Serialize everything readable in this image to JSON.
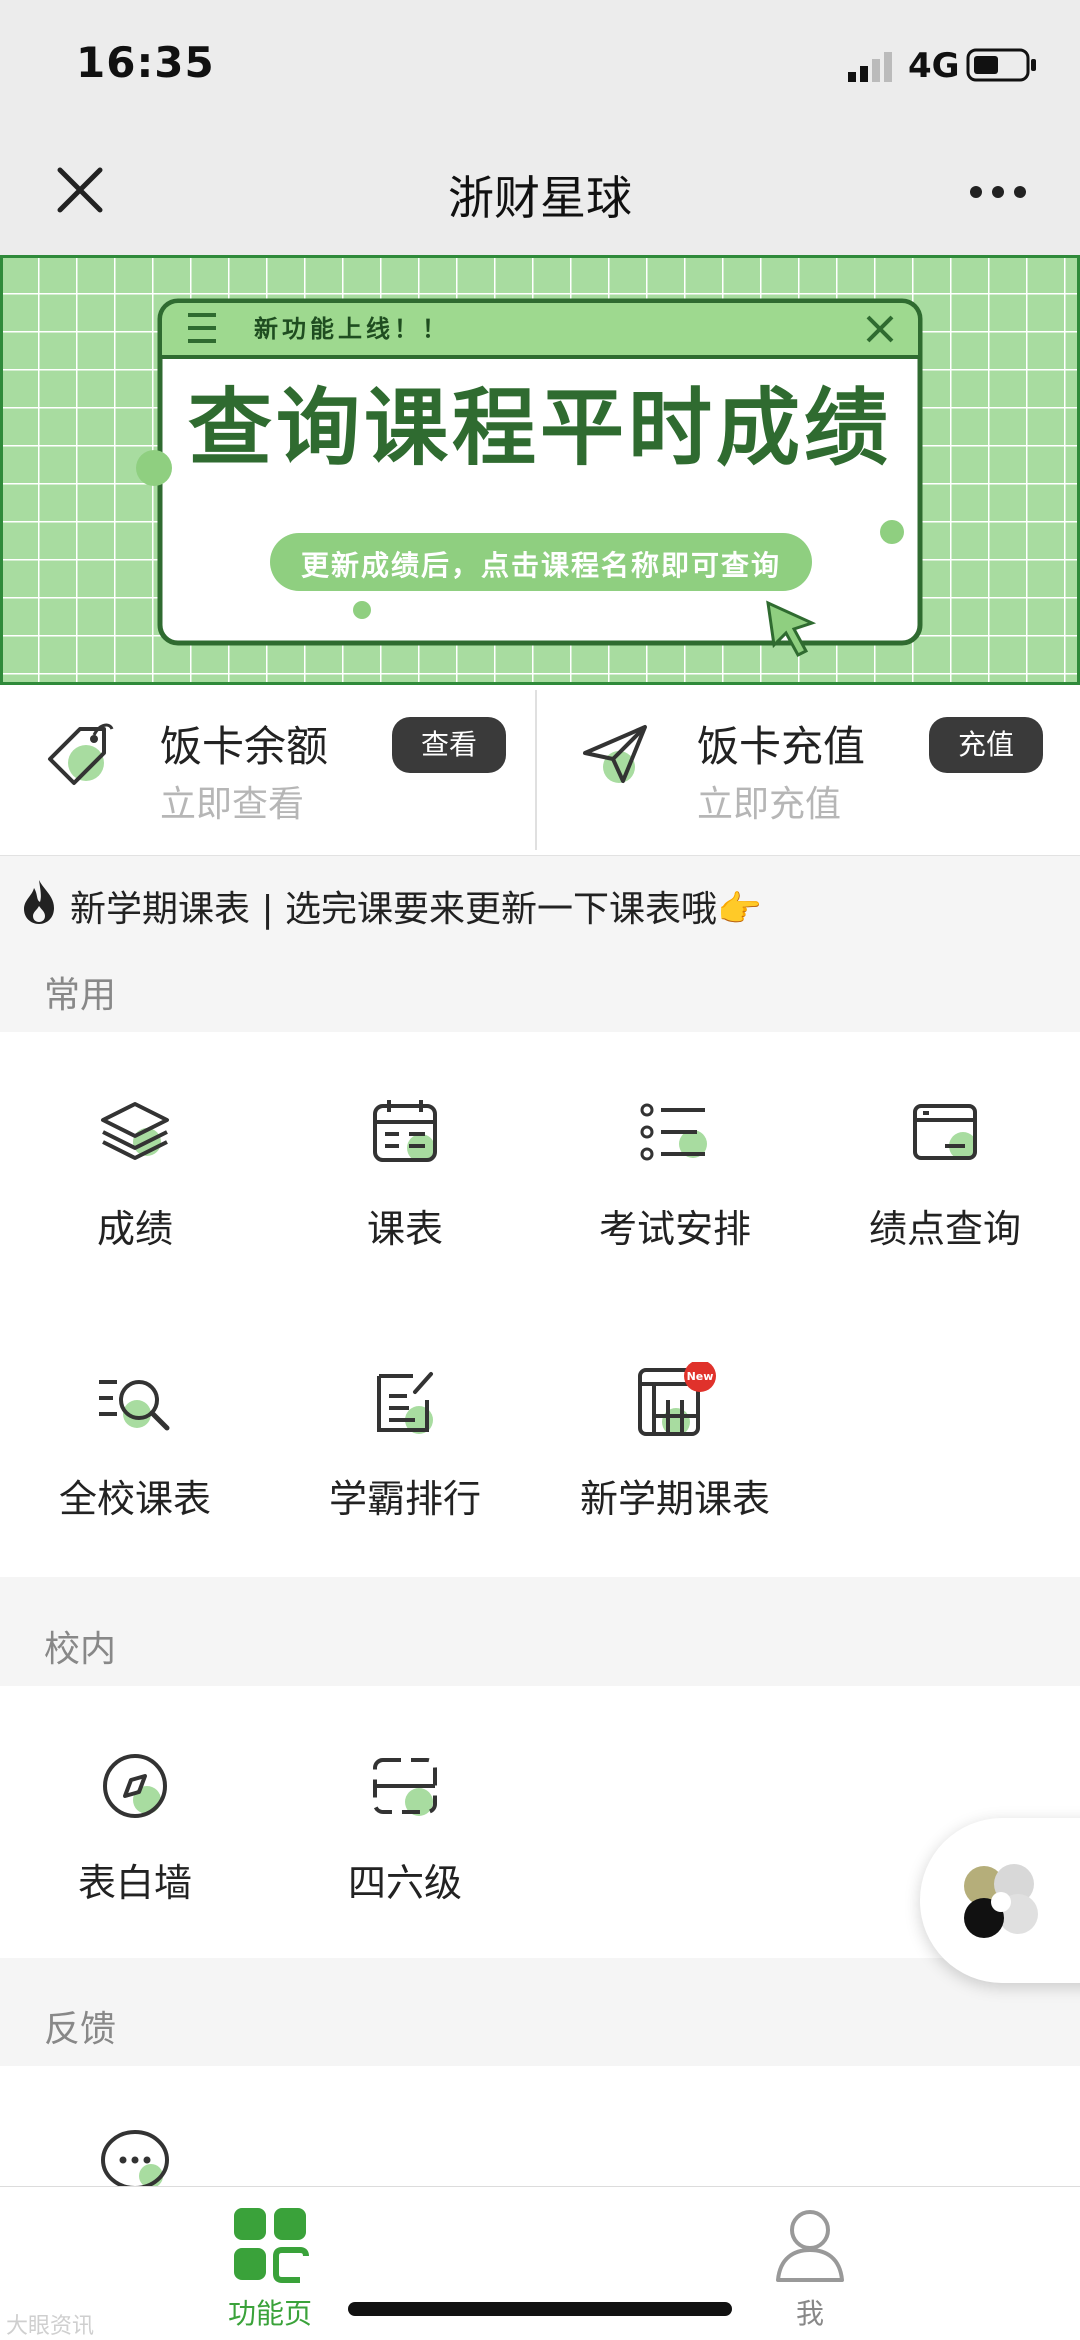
{
  "status": {
    "time": "16:35",
    "network": "4G"
  },
  "nav": {
    "title": "浙财星球"
  },
  "banner": {
    "tag": "新功能上线！！",
    "headline": "查询课程平时成绩",
    "subtitle": "更新成绩后，点击课程名称即可查询"
  },
  "cards": [
    {
      "title": "饭卡余额",
      "subtitle": "立即查看",
      "button": "查看",
      "icon": "tag-icon"
    },
    {
      "title": "饭卡充值",
      "subtitle": "立即充值",
      "button": "充值",
      "icon": "paper-plane-icon"
    }
  ],
  "notice": {
    "text": "新学期课表 | 选完课要来更新一下课表哦",
    "emoji": "👉"
  },
  "sections": {
    "common": {
      "label": "常用",
      "items": [
        {
          "label": "成绩",
          "icon": "layers-icon"
        },
        {
          "label": "课表",
          "icon": "calendar-icon"
        },
        {
          "label": "考试安排",
          "icon": "list-icon"
        },
        {
          "label": "绩点查询",
          "icon": "window-icon"
        },
        {
          "label": "全校课表",
          "icon": "search-list-icon"
        },
        {
          "label": "学霸排行",
          "icon": "edit-note-icon"
        },
        {
          "label": "新学期课表",
          "icon": "timetable-new-icon",
          "badge": "New"
        }
      ]
    },
    "campus": {
      "label": "校内",
      "items": [
        {
          "label": "表白墙",
          "icon": "compass-icon"
        },
        {
          "label": "四六级",
          "icon": "scan-card-icon"
        }
      ]
    },
    "feedback": {
      "label": "反馈",
      "items": [
        {
          "label": "",
          "icon": "chat-icon"
        }
      ]
    }
  },
  "tabbar": {
    "tabs": [
      {
        "label": "功能页",
        "active": true,
        "icon": "grid-icon"
      },
      {
        "label": "我",
        "active": false,
        "icon": "person-icon"
      }
    ]
  },
  "watermark": "大眼资讯",
  "colors": {
    "accent": "#3aa23a",
    "green_light": "#a8dca0",
    "dark_pill": "#3a3a3a"
  }
}
